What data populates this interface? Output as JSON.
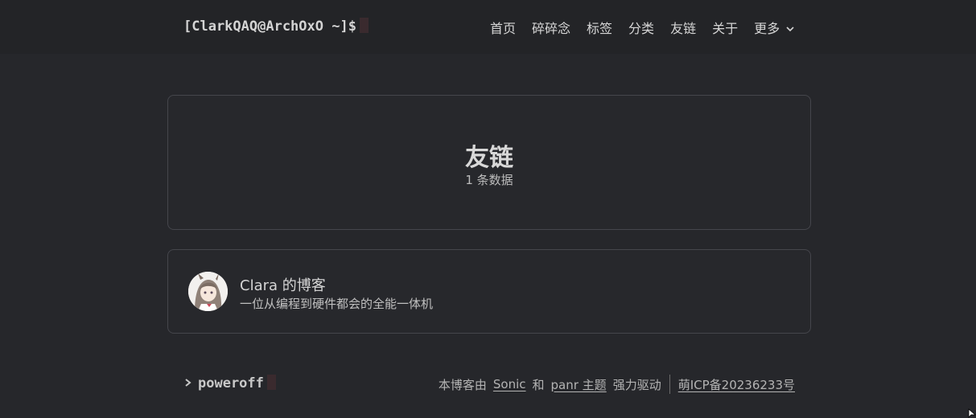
{
  "header": {
    "brand": "[ClarkQAQ@ArchOxO ~]$",
    "nav": [
      {
        "label": "首页"
      },
      {
        "label": "碎碎念"
      },
      {
        "label": "标签"
      },
      {
        "label": "分类"
      },
      {
        "label": "友链"
      },
      {
        "label": "关于"
      },
      {
        "label": "更多",
        "icon": "chevron-down-icon"
      }
    ]
  },
  "hero": {
    "title": "友链",
    "subtitle": "1 条数据"
  },
  "links": [
    {
      "name": "Clara 的博客",
      "description": "一位从编程到硬件都会的全能一体机",
      "avatar_icon": "anime-girl-avatar"
    }
  ],
  "footer": {
    "command": "poweroff",
    "powered_prefix": "本博客由",
    "engine": "Sonic",
    "and": "和",
    "theme": "panr 主题",
    "powered_suffix": "强力驱动",
    "icp": "萌ICP备20236233号"
  },
  "colors": {
    "background": "#26272b",
    "header_background": "#232427",
    "card_border": "#45464c",
    "text": "#d4d4d4"
  }
}
